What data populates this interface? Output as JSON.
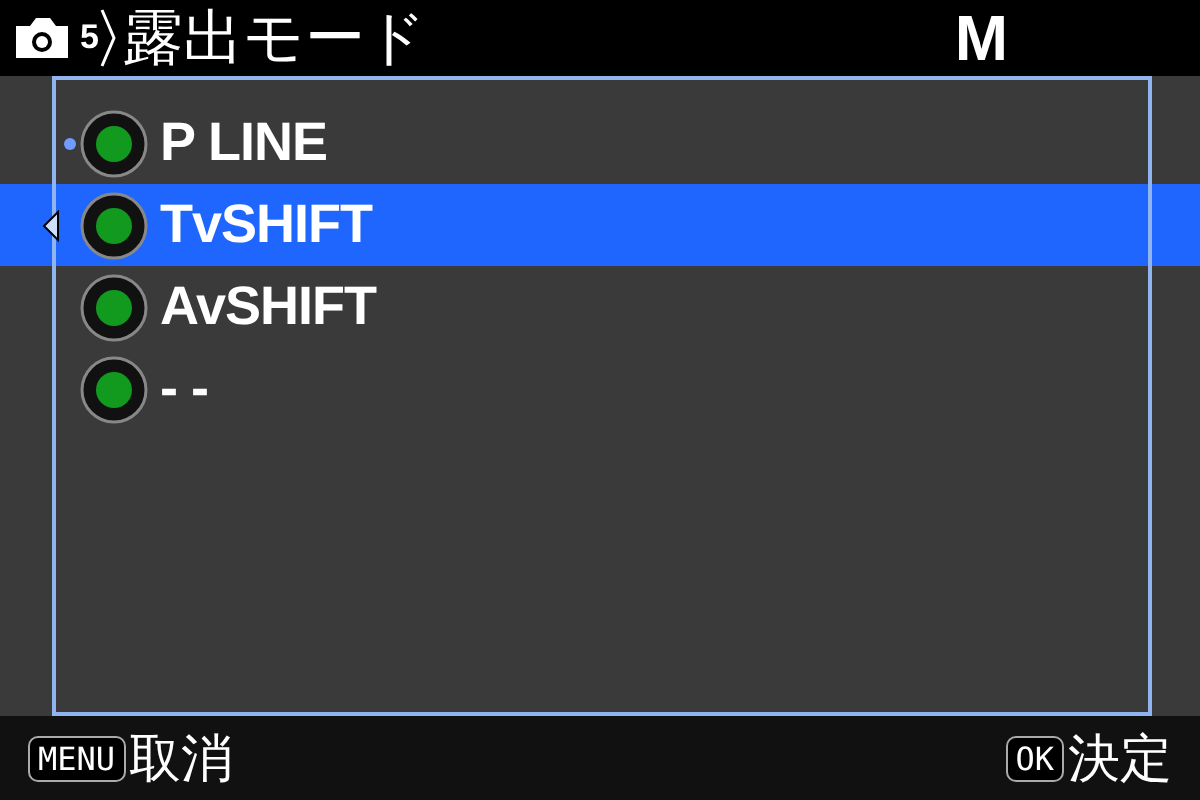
{
  "header": {
    "tab_number": "5",
    "title": "露出モード",
    "mode": "M"
  },
  "items": [
    {
      "label": "P LINE",
      "selected": false,
      "current": true
    },
    {
      "label": "TvSHIFT",
      "selected": true,
      "current": false
    },
    {
      "label": "AvSHIFT",
      "selected": false,
      "current": false
    },
    {
      "label": "- -",
      "selected": false,
      "current": false
    }
  ],
  "footer": {
    "left_key": "MENU",
    "left_action": "取消",
    "right_key": "OK",
    "right_action": "決定"
  }
}
